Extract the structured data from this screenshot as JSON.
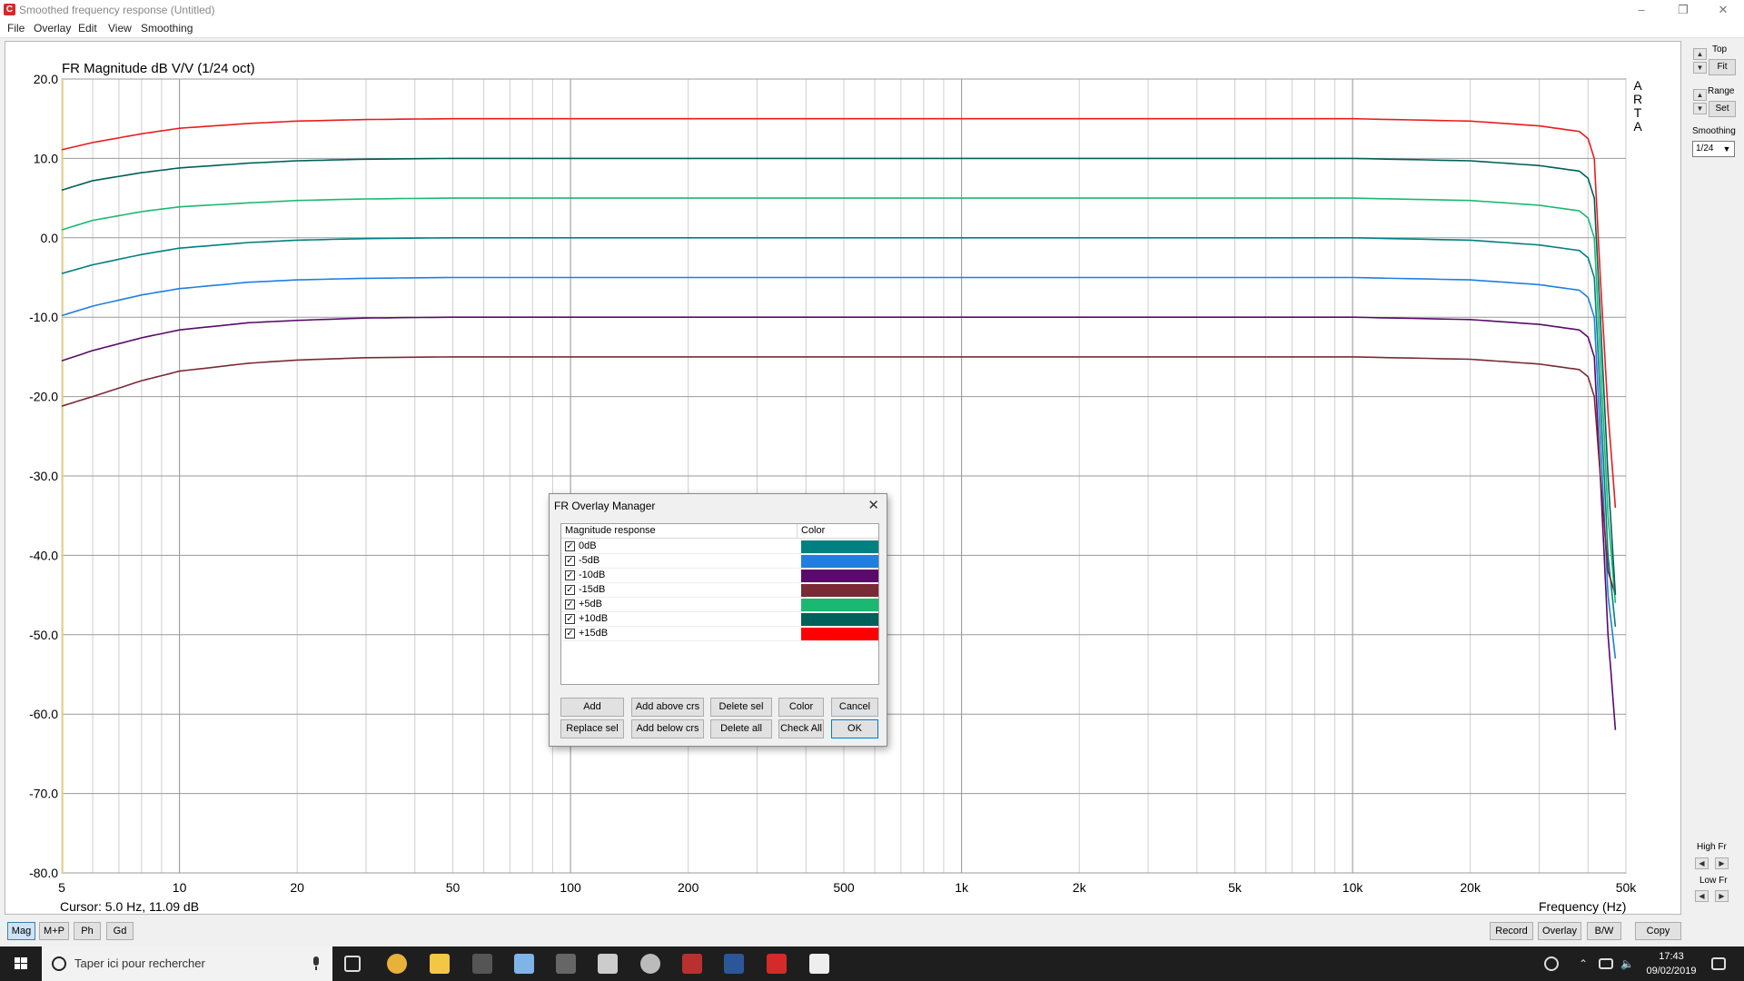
{
  "window": {
    "title": "Smoothed frequency response (Untitled)",
    "app_icon_letter": "C"
  },
  "menu": {
    "items": [
      "File",
      "Overlay",
      "Edit",
      "View",
      "Smoothing"
    ]
  },
  "plot": {
    "title": "FR Magnitude dB V/V (1/24 oct)",
    "cursor_readout": "Cursor: 5.0 Hz, 11.09 dB",
    "x_axis_label": "Frequency (Hz)",
    "watermark_letters": [
      "A",
      "R",
      "T",
      "A"
    ]
  },
  "chart_data": {
    "type": "line",
    "x_scale": "log",
    "xlim": [
      5,
      50000
    ],
    "ylim": [
      -80,
      20
    ],
    "x_ticks": [
      5,
      10,
      20,
      50,
      100,
      200,
      500,
      1000,
      2000,
      5000,
      10000,
      20000,
      50000
    ],
    "x_tick_labels": [
      "5",
      "10",
      "20",
      "50",
      "100",
      "200",
      "500",
      "1k",
      "2k",
      "5k",
      "10k",
      "20k",
      "50k"
    ],
    "y_ticks": [
      20,
      10,
      0,
      -10,
      -20,
      -30,
      -40,
      -50,
      -60,
      -70,
      -80
    ],
    "y_tick_labels": [
      "20.0",
      "10.0",
      "0.0",
      "-10.0",
      "-20.0",
      "-30.0",
      "-40.0",
      "-50.0",
      "-60.0",
      "-70.0",
      "-80.0"
    ],
    "grid": true,
    "x": [
      5,
      6,
      8,
      10,
      15,
      20,
      30,
      50,
      100,
      1000,
      10000,
      20000,
      30000,
      38000,
      40000,
      41500,
      43000,
      45000,
      47000
    ],
    "series": [
      {
        "name": "0dB",
        "color": "#008080",
        "values": [
          -4.5,
          -3.4,
          -2.1,
          -1.3,
          -0.6,
          -0.3,
          -0.1,
          0,
          0,
          0,
          0,
          -0.3,
          -0.9,
          -1.6,
          -2.5,
          -5,
          -20,
          -40,
          -49
        ]
      },
      {
        "name": "-5dB",
        "color": "#1f7fe0",
        "values": [
          -9.8,
          -8.6,
          -7.2,
          -6.4,
          -5.6,
          -5.3,
          -5.1,
          -5,
          -5,
          -5,
          -5,
          -5.3,
          -5.9,
          -6.6,
          -7.5,
          -10,
          -25,
          -45,
          -53
        ]
      },
      {
        "name": "-10dB",
        "color": "#5a0a6a",
        "values": [
          -15.5,
          -14.2,
          -12.6,
          -11.6,
          -10.7,
          -10.4,
          -10.1,
          -10,
          -10,
          -10,
          -10,
          -10.3,
          -10.9,
          -11.6,
          -12.5,
          -15,
          -30,
          -50,
          -62
        ]
      },
      {
        "name": "-15dB",
        "color": "#7a2a35",
        "values": [
          -21.2,
          -20,
          -18,
          -16.8,
          -15.8,
          -15.4,
          -15.1,
          -15,
          -15,
          -15,
          -15,
          -15.3,
          -15.9,
          -16.6,
          -17.5,
          -20,
          -30,
          -42,
          -45
        ]
      },
      {
        "name": "+5dB",
        "color": "#1ab870",
        "values": [
          1,
          2.2,
          3.3,
          3.9,
          4.4,
          4.7,
          4.9,
          5,
          5,
          5,
          5,
          4.7,
          4.1,
          3.4,
          2.5,
          0,
          -15,
          -35,
          -46
        ]
      },
      {
        "name": "+10dB",
        "color": "#00605a",
        "values": [
          6,
          7.2,
          8.2,
          8.8,
          9.4,
          9.7,
          9.9,
          10,
          10,
          10,
          10,
          9.7,
          9.1,
          8.4,
          7.5,
          5,
          -10,
          -30,
          -45
        ]
      },
      {
        "name": "+15dB",
        "color": "#e81c1c",
        "values": [
          11.09,
          12,
          13.1,
          13.8,
          14.4,
          14.7,
          14.9,
          15,
          15,
          15,
          15,
          14.7,
          14.1,
          13.4,
          12.5,
          10,
          -5,
          -22,
          -34
        ]
      }
    ]
  },
  "right_panel": {
    "top_label": "Top",
    "fit_label": "Fit",
    "range_label": "Range",
    "set_label": "Set",
    "smoothing_label": "Smoothing",
    "smoothing_value": "1/24",
    "high_fr_label": "High Fr",
    "low_fr_label": "Low Fr"
  },
  "bottom_bar": {
    "left_buttons": [
      "Mag",
      "M+P",
      "Ph",
      "Gd"
    ],
    "right_buttons": [
      "Record",
      "Overlay",
      "B/W",
      "Copy"
    ]
  },
  "dialog": {
    "title": "FR Overlay Manager",
    "col_response": "Magnitude response",
    "col_color": "Color",
    "rows": [
      {
        "label": "0dB",
        "checked": true,
        "color": "#008080"
      },
      {
        "label": "-5dB",
        "checked": true,
        "color": "#1f7fe0"
      },
      {
        "label": "-10dB",
        "checked": true,
        "color": "#5a0a6a"
      },
      {
        "label": "-15dB",
        "checked": true,
        "color": "#7a2a35"
      },
      {
        "label": "+5dB",
        "checked": true,
        "color": "#1ab870"
      },
      {
        "label": "+10dB",
        "checked": true,
        "color": "#00605a"
      },
      {
        "label": "+15dB",
        "checked": true,
        "color": "#ff0000"
      }
    ],
    "buttons_row1": [
      "Add",
      "Add above crs",
      "Delete sel",
      "Color",
      "Cancel"
    ],
    "buttons_row2": [
      "Replace sel",
      "Add below crs",
      "Delete all",
      "Check All",
      "OK"
    ]
  },
  "taskbar": {
    "search_placeholder": "Taper ici pour rechercher",
    "time": "17:43",
    "date": "09/02/2019"
  }
}
